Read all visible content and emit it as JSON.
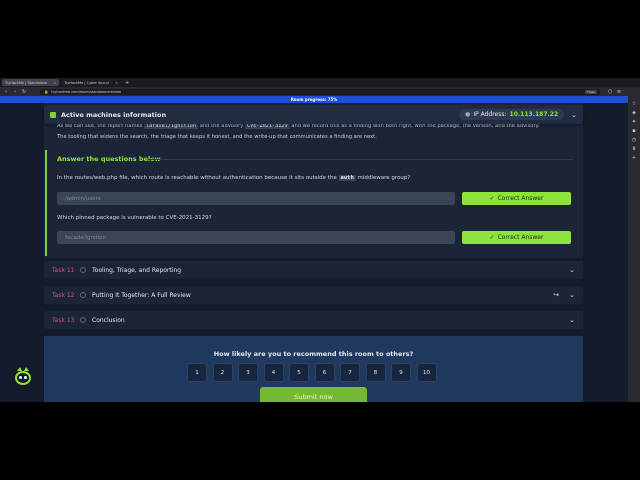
{
  "browser": {
    "tabs": [
      {
        "label": "TryHackMe | Standalone",
        "active": true
      },
      {
        "label": "TryHackMe | Cyber Securi",
        "active": false
      }
    ],
    "url": "tryhackme.com/room/standalonereview",
    "url_badge": "Flask"
  },
  "progress": {
    "label": "Room progress: 75%"
  },
  "machine": {
    "title": "Active machines information",
    "ip_label": "IP Address:",
    "ip_value": "10.113.187.22"
  },
  "content": {
    "line1_a": "As we can see, the report names",
    "line1_code1": "laravel/ignition",
    "line1_b": "and the advisory",
    "line1_code2": "CVE-2021-3129",
    "line1_c": "and we record this as a finding with both right, with the package, the version, and the advisory.",
    "line2": "The tooling that widens the search, the triage that keeps it honest, and the write-up that communicates a finding are next."
  },
  "answers": {
    "heading": "Answer the questions below",
    "questions": [
      {
        "text_a": "In the routes/web.php file, which route is reachable without authentication because it sits outside the",
        "code": "auth",
        "text_b": "middleware group?",
        "answer": "/admin/users",
        "button": "Correct Answer"
      },
      {
        "text": "Which pinned package is vulnerable to CVE-2021-3129?",
        "answer": "facade/ignition",
        "button": "Correct Answer"
      }
    ]
  },
  "tasks": [
    {
      "num": "Task 11",
      "name": "Tooling, Triage, and Reporting"
    },
    {
      "num": "Task 12",
      "name": "Putting It Together: A Full Review"
    },
    {
      "num": "Task 13",
      "name": "Conclusion"
    }
  ],
  "rating": {
    "title": "How likely are you to recommend this room to others?",
    "options": [
      "1",
      "2",
      "3",
      "4",
      "5",
      "6",
      "7",
      "8",
      "9",
      "10"
    ],
    "submit": "Submit now"
  },
  "colors": {
    "accent": "#8ee33a",
    "task_num": "#d2567a",
    "progress": "#1f4fd8"
  }
}
